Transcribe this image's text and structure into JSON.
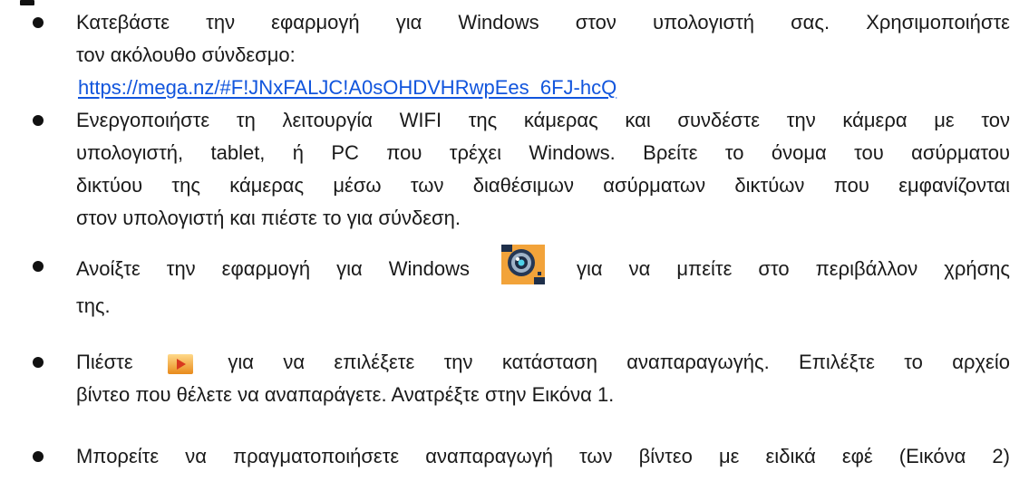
{
  "bullets": [
    {
      "lines": [
        "Κατεβάστε την εφαρμογή για Windows στον υπολογιστή σας. Χρησιμοποιήστε",
        "τον ακόλουθο σύνδεσμο:"
      ],
      "link": "https://mega.nz/#F!JNxFALJC!A0sOHDVHRwpEes_6FJ-hcQ"
    },
    {
      "lines": [
        "Ενεργοποιήστε τη λειτουργία WIFI της κάμερας και συνδέστε την κάμερα με τον",
        "υπολογιστή, tablet, ή PC που τρέχει Windows. Βρείτε το όνομα του ασύρματου",
        "δικτύου της κάμερας μέσω των διαθέσιμων ασύρματων δικτύων που εμφανίζονται",
        "στον υπολογιστή και πιέστε το για σύνδεση."
      ]
    },
    {
      "before_icon": "Ανοίξτε την εφαρμογή για Windows",
      "icon": "camera-app-icon",
      "after_icon": "για να μπείτε στο περιβάλλον χρήσης",
      "continuation": "της."
    },
    {
      "before_icon": "Πιέστε",
      "icon": "play-icon",
      "after_icon": "για να επιλέξετε την κατάσταση αναπαραγωγής. Επιλέξτε το αρχείο",
      "continuation": "βίντεο που θέλετε να αναπαράγετε. Ανατρέξτε στην Εικόνα 1."
    },
    {
      "lines": [
        "Μπορείτε να πραγματοποιήσετε αναπαραγωγή των βίντεο με ειδικά εφέ (Εικόνα 2)"
      ]
    }
  ],
  "colors": {
    "link": "#1155dd",
    "text": "#1a1a1a",
    "icon_orange": "#f2a33a",
    "icon_dark": "#1e2f4a"
  }
}
